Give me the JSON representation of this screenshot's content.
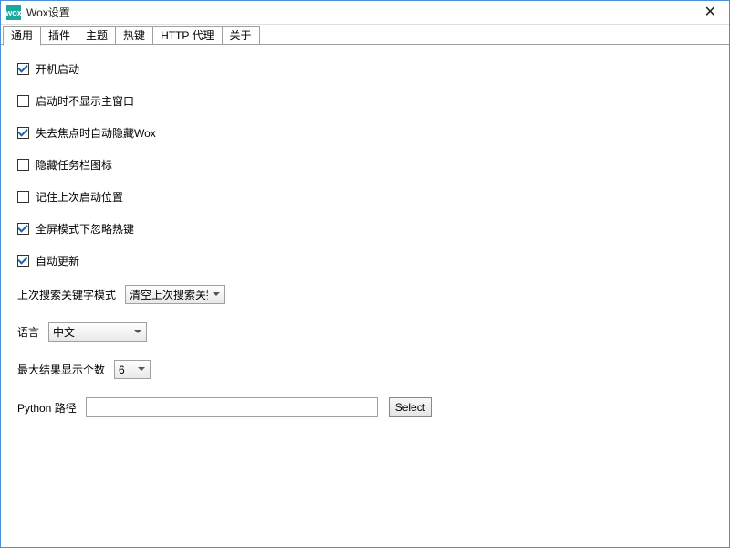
{
  "window": {
    "title": "Wox设置",
    "icon_text": "wox"
  },
  "tabs": [
    {
      "label": "通用",
      "active": true
    },
    {
      "label": "插件",
      "active": false
    },
    {
      "label": "主题",
      "active": false
    },
    {
      "label": "热键",
      "active": false
    },
    {
      "label": "HTTP 代理",
      "active": false
    },
    {
      "label": "关于",
      "active": false
    }
  ],
  "checkboxes": [
    {
      "label": "开机启动",
      "checked": true
    },
    {
      "label": "启动时不显示主窗口",
      "checked": false
    },
    {
      "label": "失去焦点时自动隐藏Wox",
      "checked": true
    },
    {
      "label": "隐藏任务栏图标",
      "checked": false
    },
    {
      "label": "记住上次启动位置",
      "checked": false
    },
    {
      "label": "全屏模式下忽略热键",
      "checked": true
    },
    {
      "label": "自动更新",
      "checked": true
    }
  ],
  "keyword_mode": {
    "label": "上次搜索关键字模式",
    "value": "清空上次搜索关键"
  },
  "language": {
    "label": "语言",
    "value": "中文"
  },
  "max_results": {
    "label": "最大结果显示个数",
    "value": "6"
  },
  "python_path": {
    "label": "Python 路径",
    "value": "",
    "button": "Select"
  }
}
